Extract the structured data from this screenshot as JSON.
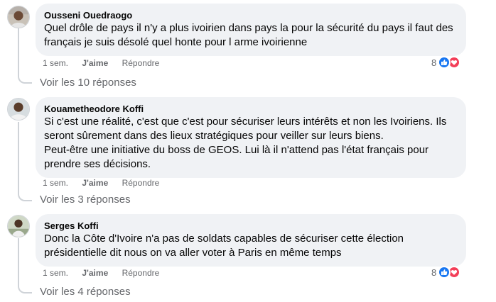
{
  "comments": [
    {
      "author": "Ousseni Ouedraogo",
      "text": "Quel drôle de pays il n'y a plus ivoirien dans pays la pour la sécurité du pays il faut des\nfrançais je suis désolé quel honte pour l arme ivoirienne",
      "time": "1 sem.",
      "like_label": "J'aime",
      "reply_label": "Répondre",
      "reaction_count": "8",
      "reactions": [
        "like-icon",
        "love-icon"
      ],
      "view_replies": "Voir les 10 réponses"
    },
    {
      "author": "Kouametheodore Koffi",
      "text": "Si c'est une réalité, c'est que c'est pour sécuriser leurs intérêts et non les Ivoiriens. Ils\nseront sûrement dans des lieux stratégiques pour veiller sur leurs biens.\nPeut-être une initiative du boss de GEOS. Lui là il n'attend pas l'état français pour\nprendre ses décisions.",
      "time": "1 sem.",
      "like_label": "J'aime",
      "reply_label": "Répondre",
      "view_replies": "Voir les 3 réponses"
    },
    {
      "author": "Serges Koffi",
      "text": "Donc la Côte d'Ivoire n'a pas de soldats capables de sécuriser cette élection\nprésidentielle dit nous on va aller voter à Paris en même temps",
      "time": "1 sem.",
      "like_label": "J'aime",
      "reply_label": "Répondre",
      "reaction_count": "8",
      "reactions": [
        "like-icon",
        "love-icon"
      ],
      "view_replies": "Voir les 4 réponses"
    }
  ],
  "colors": {
    "bubble": "#f0f2f5",
    "secondary_text": "#65676b",
    "like_blue": "#1877f2",
    "love_red": "#f33e58"
  }
}
